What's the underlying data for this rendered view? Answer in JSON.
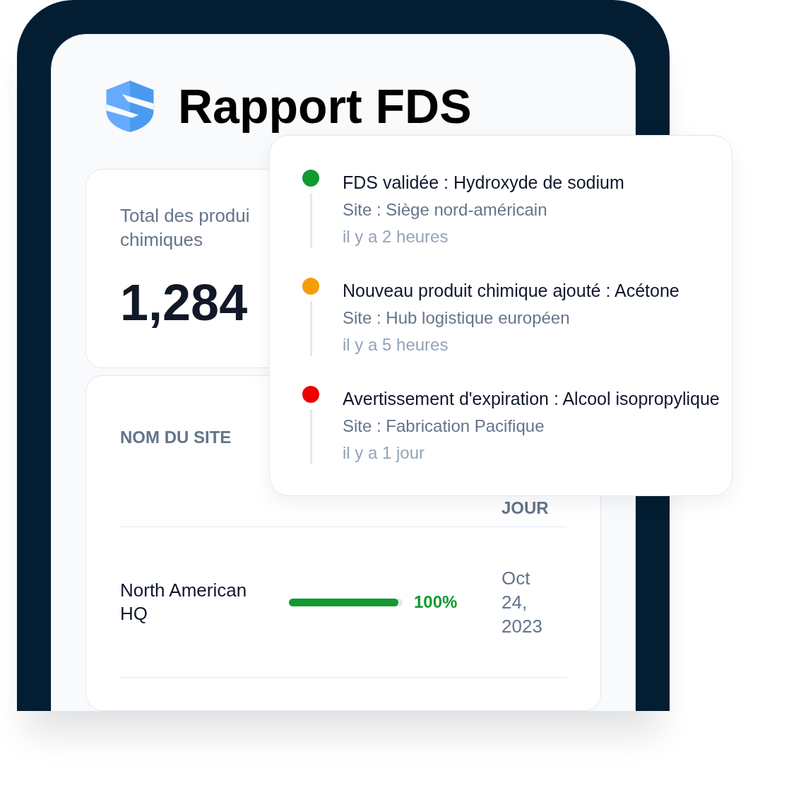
{
  "header": {
    "title": "Rapport FDS"
  },
  "stat_card": {
    "label_lines": [
      "Total des produi",
      "chimiques"
    ],
    "value": "1,284"
  },
  "table": {
    "headers": {
      "column_1": "NOM DU SITE",
      "column_3": "JOUR"
    },
    "rows": [
      {
        "site": "North American HQ",
        "progress": {
          "level": 0.96,
          "reading": "100%"
        },
        "date": "Oct 24, 2023"
      }
    ]
  },
  "activity_popup": {
    "items": [
      {
        "title": "FDS validée : Hydroxyde de sodium",
        "site": "Site : Siège nord-américain",
        "time": "il y a 2 heures",
        "color": "#109a31"
      },
      {
        "title": "Nouveau produit chimique ajouté : Acétone",
        "site": "Site : Hub logistique européen",
        "time": "il y a 5 heures",
        "color": "#f59e0b"
      },
      {
        "title": "Avertissement d'expiration : Alcool isopropylique",
        "site": "Site : Fabrication Pacifique",
        "time": "il y a 1 jour",
        "color": "#ee0000"
      }
    ]
  }
}
